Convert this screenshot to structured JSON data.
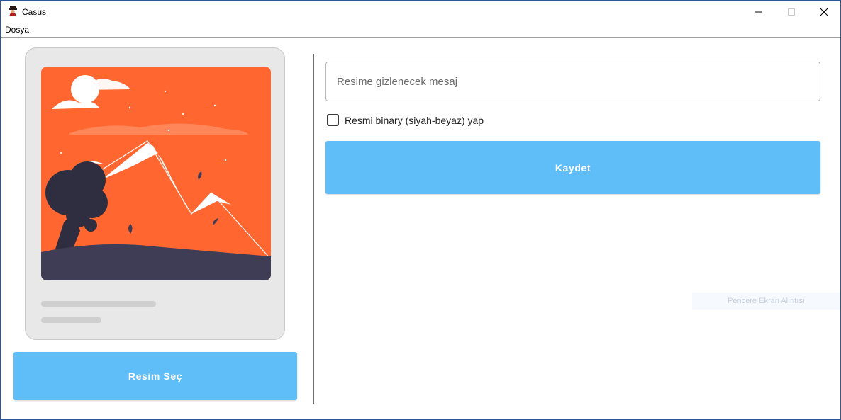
{
  "window": {
    "title": "Casus",
    "minimize_glyph": "─",
    "maximize_glyph": "☐",
    "close_glyph": "✕"
  },
  "menu": {
    "items": [
      "Dosya"
    ]
  },
  "left": {
    "preview_icon": "image-placeholder-illustration",
    "select_button": "Resim Seç"
  },
  "right": {
    "message_placeholder": "Resime gizlenecek mesaj",
    "message_value": "",
    "binary_checkbox_label": "Resmi binary (siyah-beyaz) yap",
    "binary_checked": false,
    "save_button": "Kaydet"
  },
  "overlay": {
    "activation_text": "Pencere Ekran Alıntısı"
  },
  "colors": {
    "accent_button": "#5fbdf7",
    "illustration_background": "#ff6630",
    "illustration_ground": "#3f3d56"
  }
}
